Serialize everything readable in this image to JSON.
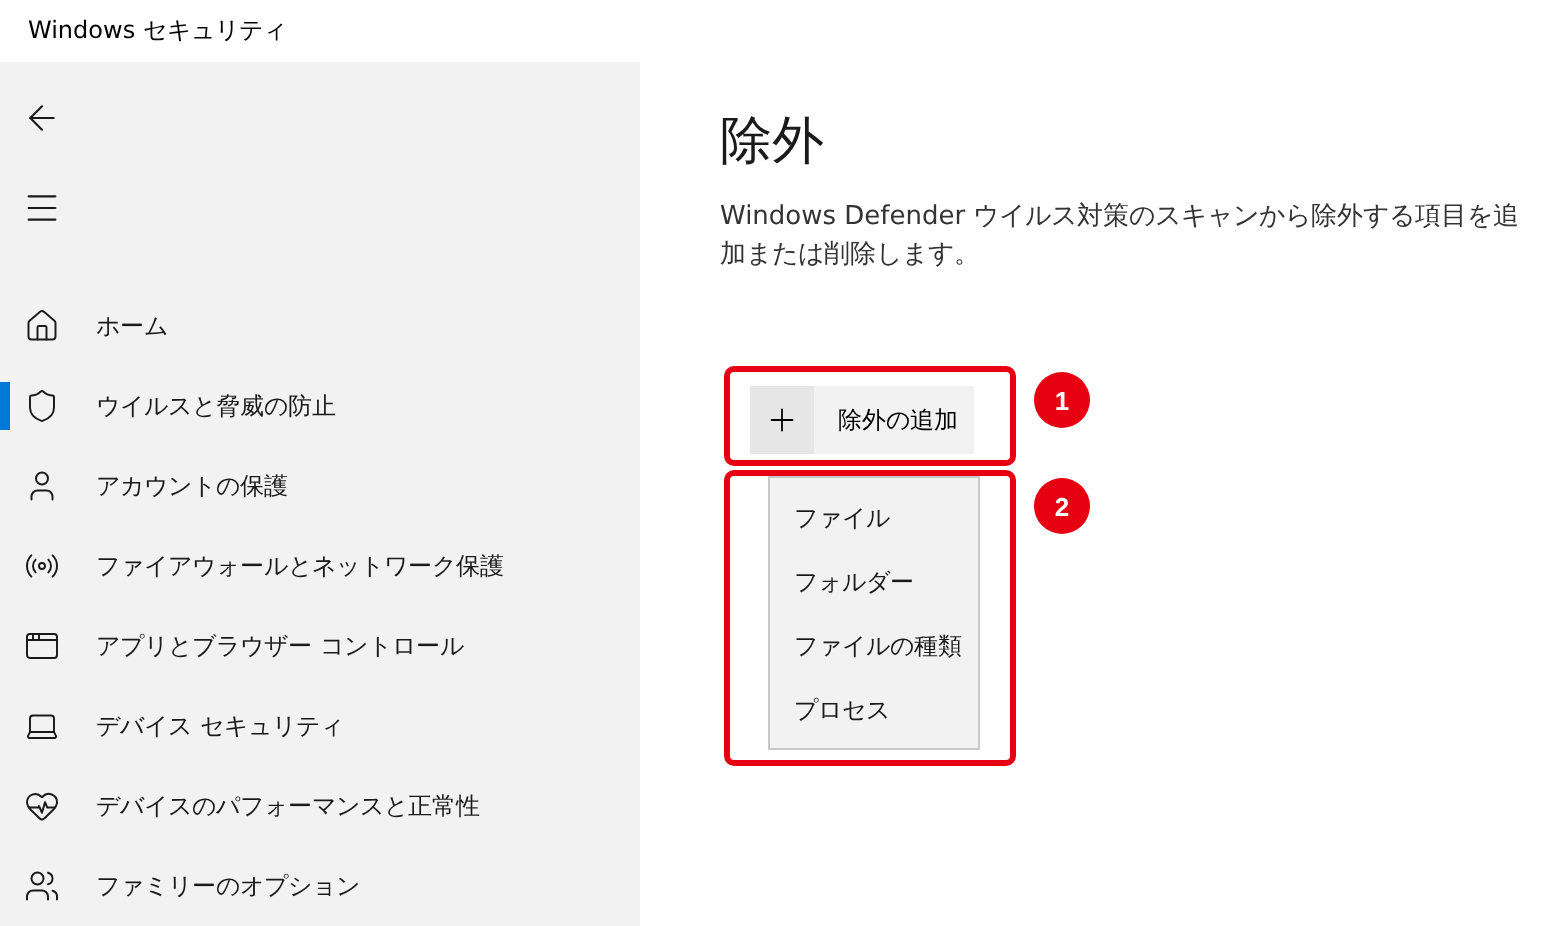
{
  "window": {
    "title": "Windows セキュリティ"
  },
  "sidebar": {
    "items": [
      {
        "kind": "home",
        "label": "ホーム",
        "selected": false
      },
      {
        "kind": "shield",
        "label": "ウイルスと脅威の防止",
        "selected": true
      },
      {
        "kind": "person",
        "label": "アカウントの保護",
        "selected": false
      },
      {
        "kind": "antenna",
        "label": "ファイアウォールとネットワーク保護",
        "selected": false
      },
      {
        "kind": "window",
        "label": "アプリとブラウザー コントロール",
        "selected": false
      },
      {
        "kind": "laptop",
        "label": "デバイス セキュリティ",
        "selected": false
      },
      {
        "kind": "heart",
        "label": "デバイスのパフォーマンスと正常性",
        "selected": false
      },
      {
        "kind": "family",
        "label": "ファミリーのオプション",
        "selected": false
      }
    ]
  },
  "page": {
    "title": "除外",
    "description": "Windows Defender ウイルス対策のスキャンから除外する項目を追加または削除します。"
  },
  "add_button": {
    "label": "除外の追加"
  },
  "menu": {
    "items": [
      {
        "label": "ファイル"
      },
      {
        "label": "フォルダー"
      },
      {
        "label": "ファイルの種類"
      },
      {
        "label": "プロセス"
      }
    ]
  },
  "annotations": [
    {
      "number": "1"
    },
    {
      "number": "2"
    }
  ]
}
